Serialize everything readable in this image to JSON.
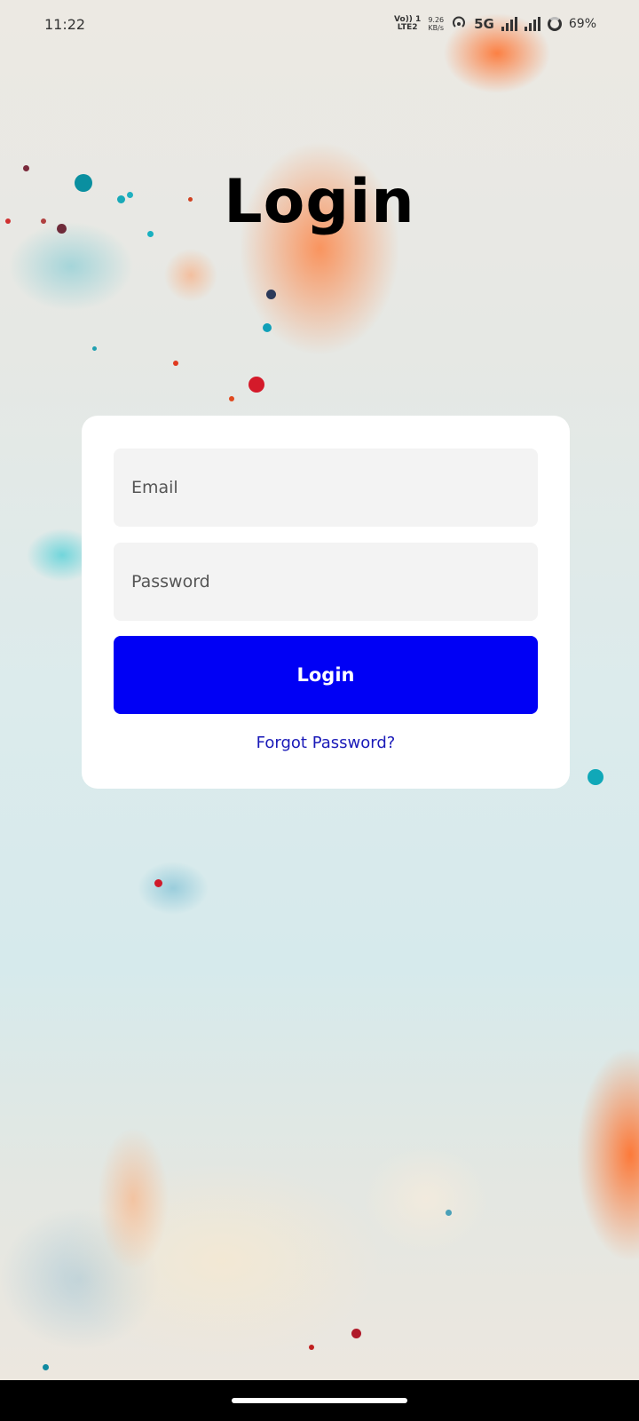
{
  "status_bar": {
    "time": "11:22",
    "volte_top": "Vo)) 1",
    "volte_bottom": "LTE2",
    "speed_top": "9.26",
    "speed_bottom": "KB/s",
    "network": "5G",
    "battery": "69%"
  },
  "page": {
    "title": "Login"
  },
  "form": {
    "email_placeholder": "Email",
    "password_placeholder": "Password",
    "login_label": "Login",
    "forgot_label": "Forgot Password?"
  },
  "colors": {
    "primary_button": "#0000f5",
    "link": "#1a1ab8",
    "card": "#ffffff",
    "input_bg": "#f3f3f3"
  }
}
